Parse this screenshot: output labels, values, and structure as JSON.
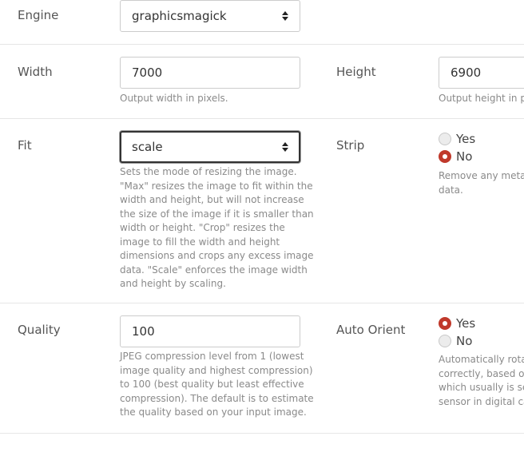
{
  "engine": {
    "label": "Engine",
    "selected": "graphicsmagick"
  },
  "width": {
    "label": "Width",
    "value": "7000",
    "help": "Output width in pixels."
  },
  "height": {
    "label": "Height",
    "value": "6900",
    "help": "Output height in pi"
  },
  "fit": {
    "label": "Fit",
    "selected": "scale",
    "help": [
      "Sets the mode of resizing the image.",
      "\"Max\" resizes the image to fit within the",
      "width and height, but will not increase",
      "the size of the image if it is smaller than",
      "width or height. \"Crop\" resizes the",
      "image to fill the width and height",
      "dimensions and crops any excess image",
      "data. \"Scale\" enforces the image width",
      "and height by scaling."
    ]
  },
  "strip": {
    "label": "Strip",
    "options": [
      {
        "label": "Yes",
        "selected": false
      },
      {
        "label": "No",
        "selected": true
      }
    ],
    "help": [
      "Remove any metad",
      "data."
    ]
  },
  "quality": {
    "label": "Quality",
    "value": "100",
    "help": [
      "JPEG compression level from 1 (lowest",
      "image quality and highest compression)",
      "to 100 (best quality but least effective",
      "compression). The default is to estimate",
      "the quality based on your input image."
    ]
  },
  "auto_orient": {
    "label": "Auto Orient",
    "options": [
      {
        "label": "Yes",
        "selected": true
      },
      {
        "label": "No",
        "selected": false
      }
    ],
    "help": [
      "Automatically rotat",
      "correctly, based on",
      "which usually is set",
      "sensor in digital ca"
    ]
  },
  "colors": {
    "accent": "#c0392b",
    "help_text": "#8a8a8a",
    "divider": "#e6e6e6"
  }
}
